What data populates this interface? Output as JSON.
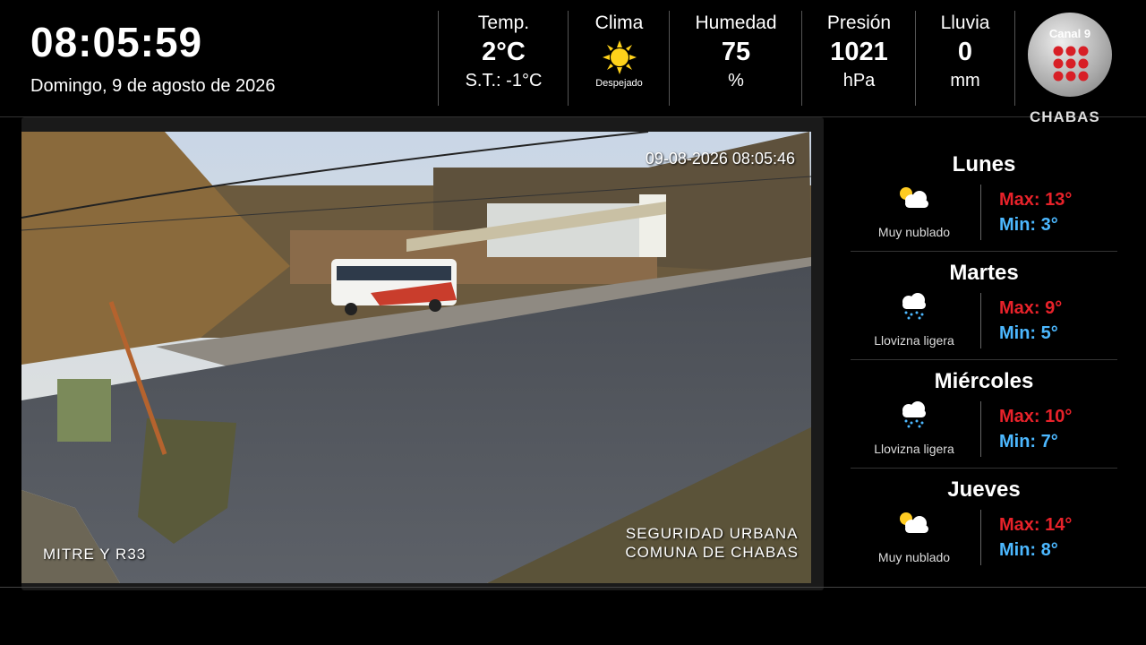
{
  "header": {
    "time": "08:05:59",
    "date": "Domingo, 9 de agosto de 2026"
  },
  "stats": {
    "temp": {
      "label": "Temp.",
      "value": "2°C",
      "feels": "S.T.: -1°C"
    },
    "clima": {
      "label": "Clima",
      "condition": "Despejado",
      "icon": "sun-icon"
    },
    "humedad": {
      "label": "Humedad",
      "value": "75",
      "unit": "%"
    },
    "presion": {
      "label": "Presión",
      "value": "1021",
      "unit": "hPa"
    },
    "lluvia": {
      "label": "Lluvia",
      "value": "0",
      "unit": "mm"
    }
  },
  "logo": {
    "channel": "Canal 9",
    "town": "CHABAS"
  },
  "camera": {
    "timestamp": "09-08-2026 08:05:46",
    "location": "MITRE Y R33",
    "org_line1": "SEGURIDAD URBANA",
    "org_line2": "COMUNA DE CHABAS"
  },
  "forecast": [
    {
      "day": "Lunes",
      "condition": "Muy nublado",
      "icon": "partly-cloudy-icon",
      "max": "Max: 13°",
      "min": "Min: 3°"
    },
    {
      "day": "Martes",
      "condition": "Llovizna ligera",
      "icon": "drizzle-icon",
      "max": "Max: 9°",
      "min": "Min: 5°"
    },
    {
      "day": "Miércoles",
      "condition": "Llovizna ligera",
      "icon": "drizzle-icon",
      "max": "Max: 10°",
      "min": "Min: 7°"
    },
    {
      "day": "Jueves",
      "condition": "Muy nublado",
      "icon": "partly-cloudy-icon",
      "max": "Max: 14°",
      "min": "Min: 8°"
    }
  ],
  "colors": {
    "max": "#e8222a",
    "min": "#4cb8ff",
    "logo_red": "#d81f26"
  }
}
